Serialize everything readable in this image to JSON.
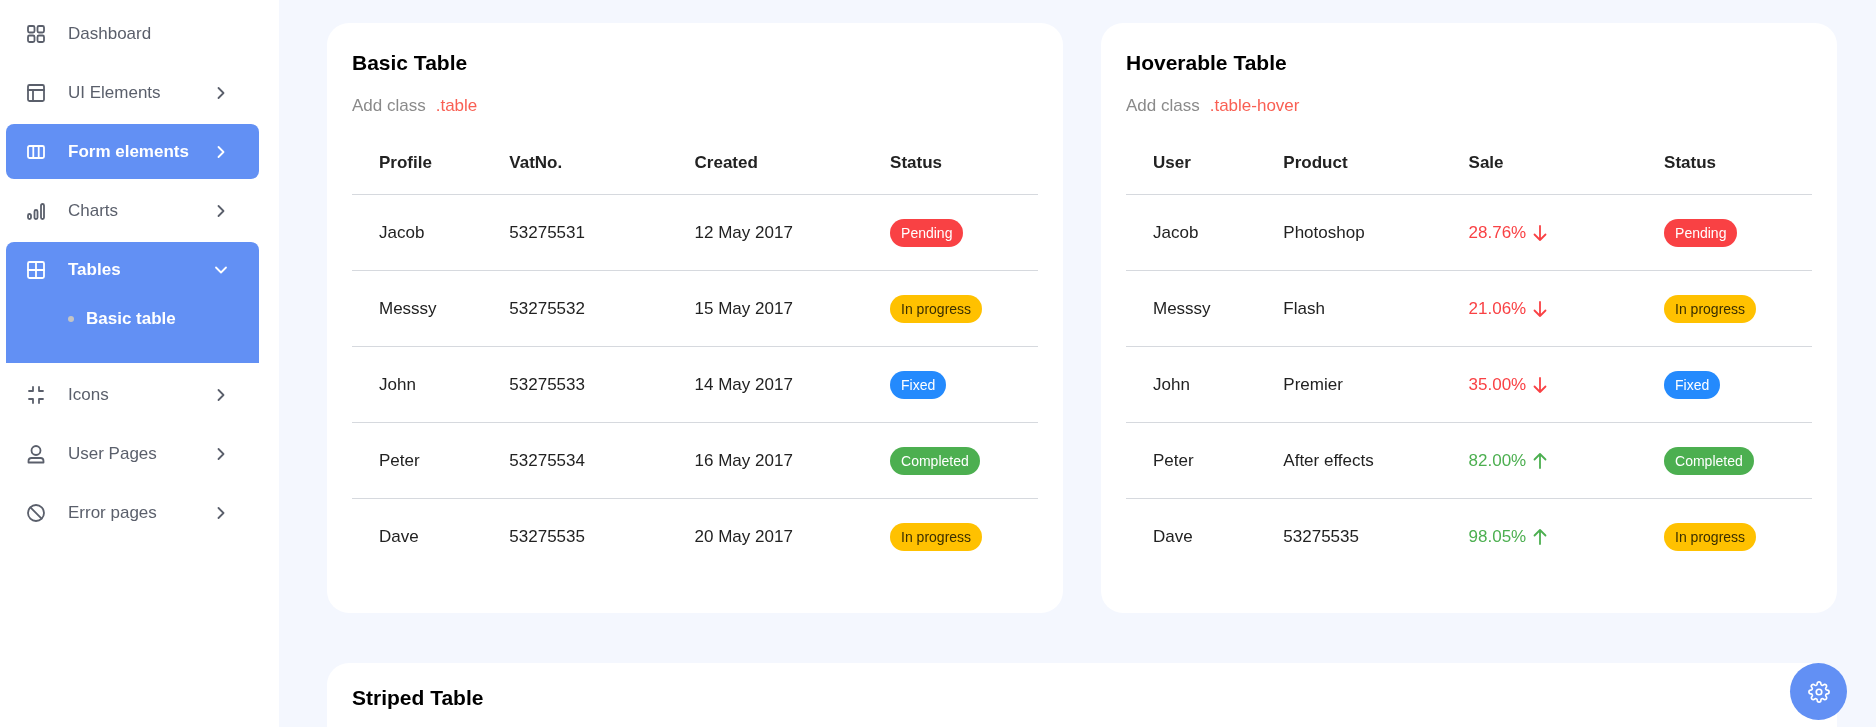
{
  "sidebar": {
    "items": [
      {
        "label": "Dashboard",
        "selected": false
      },
      {
        "label": "UI Elements",
        "selected": false,
        "expanded": false
      },
      {
        "label": "Form elements",
        "selected": true,
        "expanded": false
      },
      {
        "label": "Charts",
        "selected": false,
        "expanded": false
      },
      {
        "label": "Tables",
        "selected": true,
        "expanded": true,
        "children": [
          {
            "label": "Basic table",
            "selected": true
          }
        ]
      },
      {
        "label": "Icons",
        "selected": false,
        "expanded": false
      },
      {
        "label": "User Pages",
        "selected": false,
        "expanded": false
      },
      {
        "label": "Error pages",
        "selected": false,
        "expanded": false
      }
    ]
  },
  "cards": [
    {
      "title": "Basic Table",
      "hint": "Add class",
      "class_name": ".table",
      "columns": [
        "Profile",
        "VatNo.",
        "Created",
        "Status"
      ],
      "rows": [
        {
          "cells": [
            "Jacob",
            "53275531",
            "12 May 2017"
          ],
          "status": {
            "label": "Pending",
            "color": "#f94144"
          }
        },
        {
          "cells": [
            "Messsy",
            "53275532",
            "15 May 2017"
          ],
          "status": {
            "label": "In progress",
            "color": "#ffc100"
          }
        },
        {
          "cells": [
            "John",
            "53275533",
            "14 May 2017"
          ],
          "status": {
            "label": "Fixed",
            "color": "#248afd"
          }
        },
        {
          "cells": [
            "Peter",
            "53275534",
            "16 May 2017"
          ],
          "status": {
            "label": "Completed",
            "color": "#4caf50"
          }
        },
        {
          "cells": [
            "Dave",
            "53275535",
            "20 May 2017"
          ],
          "status": {
            "label": "In progress",
            "color": "#ffc100"
          }
        }
      ]
    },
    {
      "title": "Hoverable Table",
      "hint": "Add class",
      "class_name": ".table-hover",
      "columns": [
        "User",
        "Product",
        "Sale",
        "Status"
      ],
      "rows": [
        {
          "cells": [
            "Jacob",
            "Photoshop"
          ],
          "sale": {
            "value": "28.76%",
            "kind": "down"
          },
          "status": {
            "label": "Pending",
            "color": "#f94144"
          }
        },
        {
          "cells": [
            "Messsy",
            "Flash"
          ],
          "sale": {
            "value": "21.06%",
            "kind": "down"
          },
          "status": {
            "label": "In progress",
            "color": "#ffc100"
          }
        },
        {
          "cells": [
            "John",
            "Premier"
          ],
          "sale": {
            "value": "35.00%",
            "kind": "down"
          },
          "status": {
            "label": "Fixed",
            "color": "#248afd"
          }
        },
        {
          "cells": [
            "Peter",
            "After effects"
          ],
          "sale": {
            "value": "82.00%",
            "kind": "up"
          },
          "status": {
            "label": "Completed",
            "color": "#4caf50"
          }
        },
        {
          "cells": [
            "Dave",
            "53275535"
          ],
          "sale": {
            "value": "98.05%",
            "kind": "up"
          },
          "status": {
            "label": "In progress",
            "color": "#ffc100"
          }
        }
      ]
    }
  ],
  "striped_card": {
    "title": "Striped Table"
  }
}
